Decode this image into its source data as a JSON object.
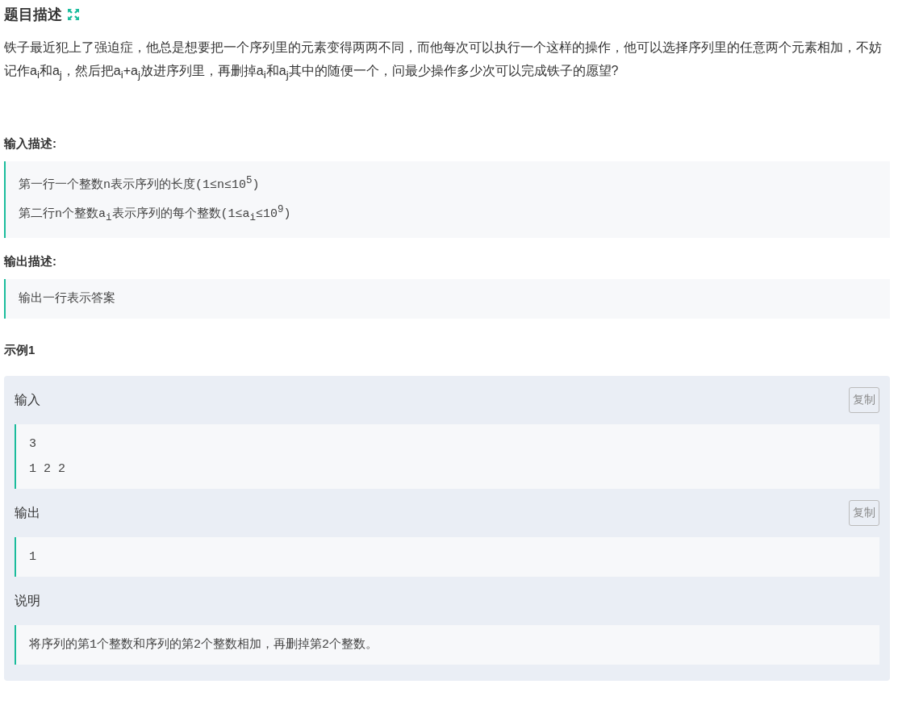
{
  "problem": {
    "title": "题目描述",
    "description": "铁子最近犯上了强迫症，他总是想要把一个序列里的元素变得两两不同，而他每次可以执行一个这样的操作，他可以选择序列里的任意两个元素相加，不妨记作a$_{i}$和a$_{j}$，然后把a$_{i}$+a$_{j}$放进序列里，再删掉a$_{i}$和a$_{j}$其中的随便一个，问最少操作多少次可以完成铁子的愿望?"
  },
  "sections": [
    {
      "heading": "输入描述:",
      "lines": [
        "第一行一个整数n表示序列的长度(1≤n≤10$^{5}$)",
        "第二行n个整数a$_{i}$表示序列的每个整数(1≤a$_{i}$≤10$^{9}$)"
      ]
    },
    {
      "heading": "输出描述:",
      "lines": [
        "输出一行表示答案"
      ]
    }
  ],
  "example": {
    "title": "示例1",
    "blocks": [
      {
        "label": "输入",
        "copy_button": "复制",
        "lines": [
          "3",
          "1 2 2"
        ]
      },
      {
        "label": "输出",
        "copy_button": "复制",
        "lines": [
          "1"
        ]
      },
      {
        "label": "说明",
        "lines": [
          "将序列的第1个整数和序列的第2个整数相加，再删掉第2个整数。"
        ]
      }
    ]
  }
}
